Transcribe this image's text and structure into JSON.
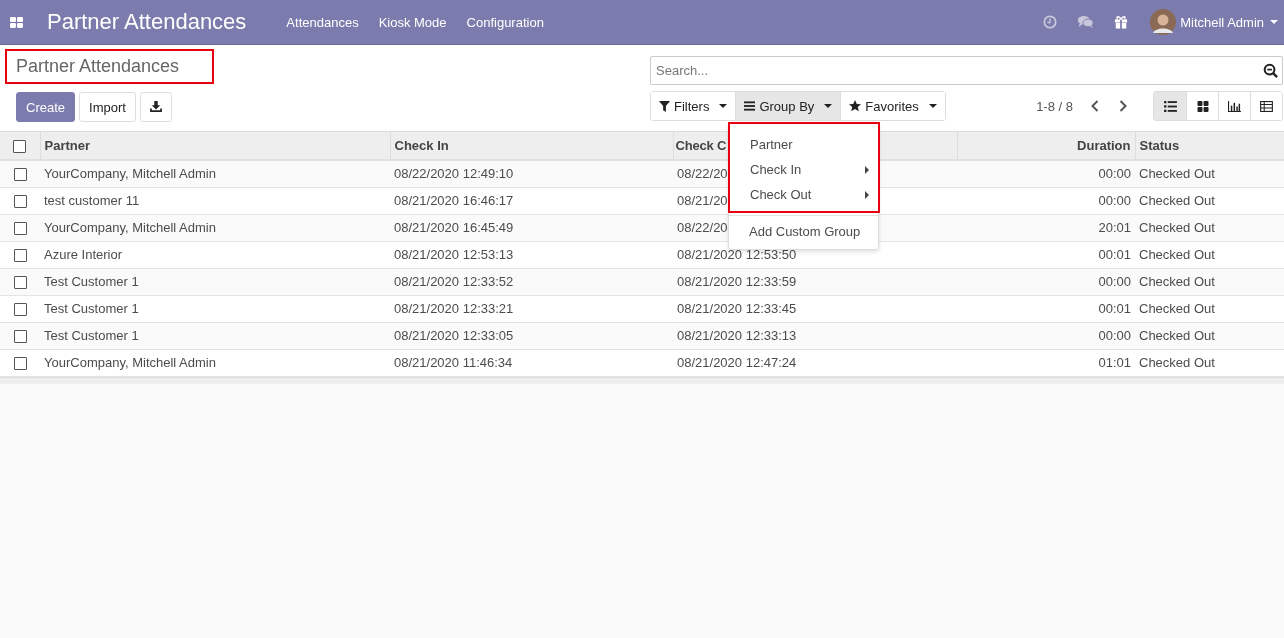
{
  "navbar": {
    "app_title": "Partner Attendances",
    "menu": [
      "Attendances",
      "Kiosk Mode",
      "Configuration"
    ],
    "user": "Mitchell Admin"
  },
  "breadcrumb": "Partner Attendances",
  "buttons": [
    {
      "label": "Create",
      "kind": "primary"
    },
    {
      "label": "Import",
      "kind": "secondary"
    },
    {
      "kind": "download"
    }
  ],
  "search": {
    "placeholder": "Search..."
  },
  "search_buttons": [
    {
      "label": "Filters",
      "selected": false
    },
    {
      "label": "Group By",
      "selected": true
    },
    {
      "label": "Favorites",
      "selected": false
    }
  ],
  "pager": "1-8 / 8",
  "views": [
    {
      "selected": true
    },
    {
      "selected": false
    },
    {
      "selected": false
    },
    {
      "selected": false
    }
  ],
  "dropdown": {
    "items": [
      {
        "label": "Partner",
        "kind": "option"
      },
      {
        "label": "Check In",
        "kind": "submenu"
      },
      {
        "label": "Check Out",
        "kind": "submenu"
      },
      {
        "label": "Add Custom Group",
        "kind": "custom"
      }
    ]
  },
  "table": {
    "select_all_checked": false,
    "columns": [
      "Partner",
      "Check In",
      "Check C",
      "Duration",
      "Status"
    ],
    "rows": [
      {
        "checked": false,
        "cells": [
          "YourCompany, Mitchell Admin",
          "08/22/2020 12:49:10",
          "08/22/20",
          "00:00",
          "Checked Out"
        ]
      },
      {
        "checked": false,
        "cells": [
          "test customer 11",
          "08/21/2020 16:46:17",
          "08/21/20",
          "00:00",
          "Checked Out"
        ]
      },
      {
        "checked": false,
        "cells": [
          "YourCompany, Mitchell Admin",
          "08/21/2020 16:45:49",
          "08/22/20",
          "20:01",
          "Checked Out"
        ]
      },
      {
        "checked": false,
        "cells": [
          "Azure Interior",
          "08/21/2020 12:53:13",
          "08/21/2020 12:53:50",
          "00:01",
          "Checked Out"
        ]
      },
      {
        "checked": false,
        "cells": [
          "Test Customer 1",
          "08/21/2020 12:33:52",
          "08/21/2020 12:33:59",
          "00:00",
          "Checked Out"
        ]
      },
      {
        "checked": false,
        "cells": [
          "Test Customer 1",
          "08/21/2020 12:33:21",
          "08/21/2020 12:33:45",
          "00:01",
          "Checked Out"
        ]
      },
      {
        "checked": false,
        "cells": [
          "Test Customer 1",
          "08/21/2020 12:33:05",
          "08/21/2020 12:33:13",
          "00:00",
          "Checked Out"
        ]
      },
      {
        "checked": false,
        "cells": [
          "YourCompany, Mitchell Admin",
          "08/21/2020 11:46:34",
          "08/21/2020 12:47:24",
          "01:01",
          "Checked Out"
        ]
      }
    ]
  }
}
